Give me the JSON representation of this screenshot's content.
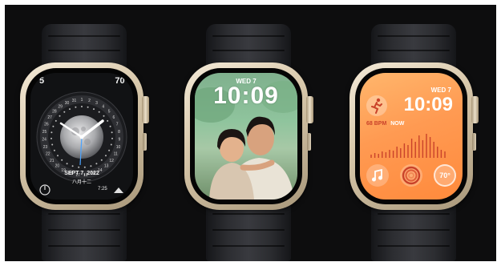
{
  "watch_faces": [
    {
      "name": "lunar",
      "complication_top_left": "5",
      "complication_top_right": "70°",
      "date": "SEPT 7, 2022",
      "lunar_date": "八月十二",
      "bottom_right_time": "7:25",
      "ring_numbers": [
        "1",
        "2",
        "3",
        "4",
        "5",
        "6",
        "7",
        "8",
        "9",
        "10",
        "11",
        "12",
        "13",
        "14",
        "15",
        "16",
        "17",
        "18",
        "19",
        "20",
        "21",
        "22",
        "23",
        "24",
        "25",
        "26",
        "27",
        "28",
        "29",
        "30",
        "31"
      ],
      "colors": {
        "hands": "#ffffff",
        "seconds": "#4aa3ff"
      }
    },
    {
      "name": "portraits",
      "day": "WED 7",
      "time": "10:09"
    },
    {
      "name": "modular-gradient",
      "day": "WED 7",
      "time": "10:09",
      "heart_rate": "68 BPM",
      "heart_rate_status": "NOW",
      "temperature": "70°",
      "icons": [
        "running-figure-icon",
        "music-note-icon",
        "activity-rings-icon"
      ],
      "colors": {
        "accent": "#ff8a3c",
        "label": "#c9422a"
      }
    }
  ]
}
